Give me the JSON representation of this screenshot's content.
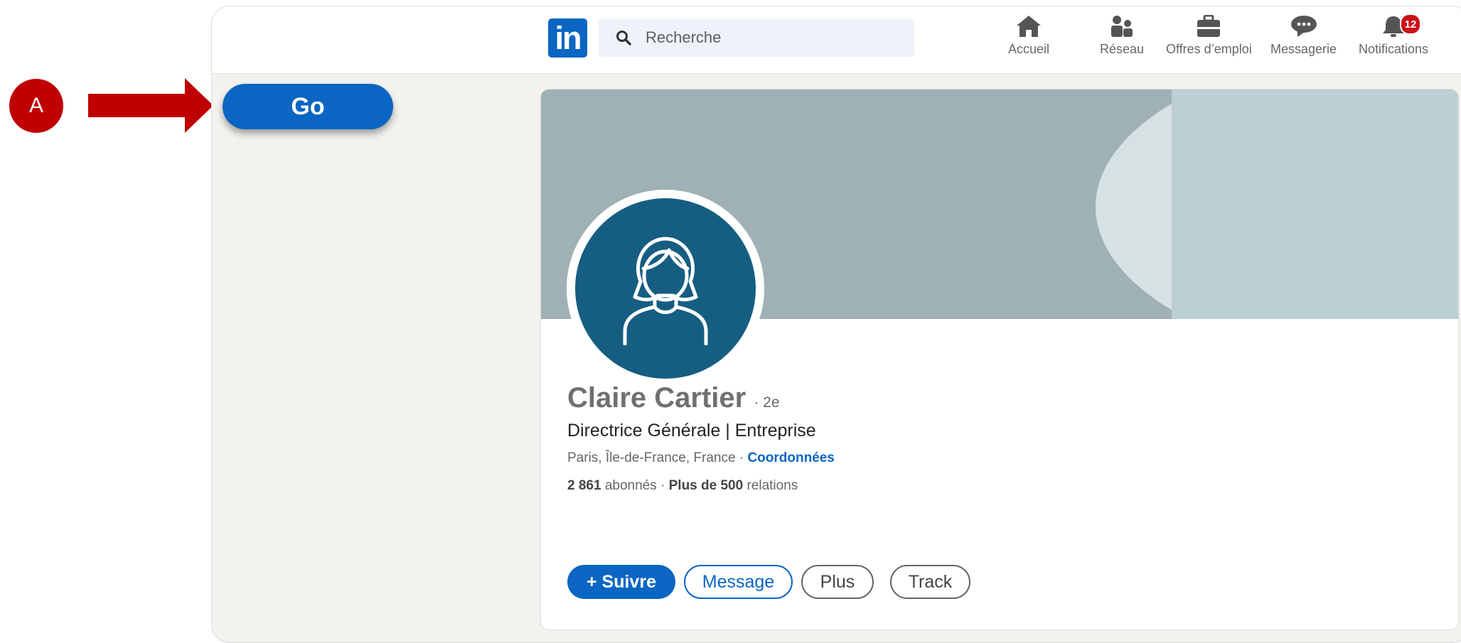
{
  "annotation": {
    "label": "A"
  },
  "header": {
    "logo_text": "in",
    "search": {
      "placeholder": "Recherche",
      "value": ""
    },
    "nav": [
      {
        "label": "Accueil",
        "icon": "home-icon"
      },
      {
        "label": "Réseau",
        "icon": "network-icon"
      },
      {
        "label": "Offres d’emploi",
        "icon": "briefcase-icon"
      },
      {
        "label": "Messagerie",
        "icon": "message-icon"
      },
      {
        "label": "Notifications",
        "icon": "bell-icon",
        "badge": "12"
      }
    ]
  },
  "go_button": {
    "label": "Go"
  },
  "profile": {
    "name": "Claire Cartier",
    "degree": "· 2e",
    "headline": "Directrice Générale | Entreprise",
    "location": "Paris, Île-de-France, France",
    "location_sep": " · ",
    "contact_link": "Coordonnées",
    "followers_count": "2 861",
    "followers_label": " abonnés ",
    "relations_sep": " · ",
    "relations_count": "Plus de 500",
    "relations_label": " relations"
  },
  "actions": {
    "follow": "+ Suivre",
    "message": "Message",
    "more": "Plus",
    "track": "Track"
  },
  "colors": {
    "brand": "#0a66c2",
    "annotation_red": "#c00000",
    "avatar_bg": "#155e82",
    "notification_badge": "#cc1016"
  }
}
